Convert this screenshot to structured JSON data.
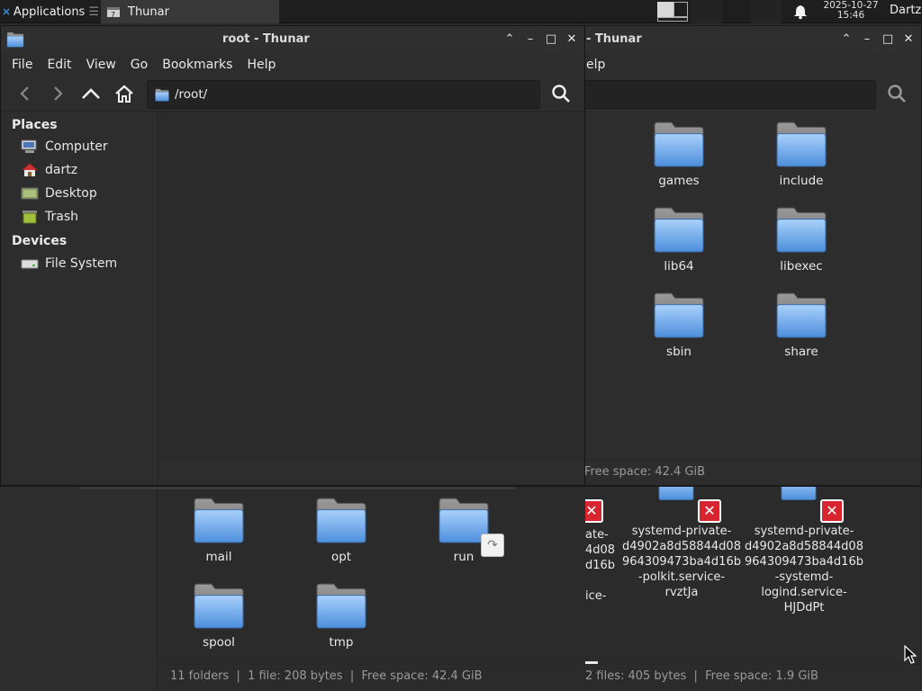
{
  "text": {
    "panel": {
      "apps_label": "Applications",
      "task_label": "Thunar",
      "clock_date": "2025-10-27",
      "clock_time": "15:46",
      "user": "Dartz"
    },
    "back_window": {
      "title": "- Thunar",
      "menu_help_partial": "elp",
      "middle_status": "Free space: 42.4 GiB",
      "bottom_status_left": "11 folders  |  1 file: 208 bytes  |  Free space: 42.4 GiB",
      "bottom_status_right": "2 files: 405 bytes  |  Free space: 1.9 GiB",
      "right_folders": [
        {
          "label": "games"
        },
        {
          "label": "include"
        },
        {
          "label": "lib64"
        },
        {
          "label": "libexec"
        },
        {
          "label": "sbin"
        },
        {
          "label": "share"
        }
      ],
      "bottom_folders": [
        {
          "label": "mail"
        },
        {
          "label": "opt"
        },
        {
          "label": "run"
        },
        {
          "label": "spool"
        },
        {
          "label": "tmp"
        }
      ],
      "private_items": [
        {
          "lines": [
            "ate-",
            "4d08",
            "d16b",
            "",
            "ice-"
          ]
        },
        {
          "lines": [
            "systemd-private-",
            "d4902a8d58844d08",
            "964309473ba4d16b",
            "-polkit.service-",
            "rvztJa"
          ]
        },
        {
          "lines": [
            "systemd-private-",
            "d4902a8d58844d08",
            "964309473ba4d16b",
            "-systemd-",
            "logind.service-",
            "HJDdPt"
          ]
        }
      ]
    },
    "front_window": {
      "title": "root - Thunar",
      "menu": [
        "File",
        "Edit",
        "View",
        "Go",
        "Bookmarks",
        "Help"
      ],
      "path": "/root/",
      "sidebar": {
        "places_header": "Places",
        "places": [
          "Computer",
          "dartz",
          "Desktop",
          "Trash"
        ],
        "devices_header": "Devices",
        "devices": [
          "File System"
        ]
      }
    }
  },
  "meta": {
    "panel": {
      "apps_icon": "xfce-logo-icon",
      "task_icon": "thunar-icon",
      "bell_icon": "notification-bell-icon"
    },
    "front_window": {
      "sidebar": {
        "places_icons": [
          "computer-icon",
          "home-icon",
          "desktop-icon",
          "trash-icon"
        ],
        "devices_icons": [
          "drive-icon"
        ]
      }
    },
    "colors": {
      "panel_bg": "#1e1e1e",
      "window_bg": "#2d2d2d",
      "folder_blue": "#5d9ee6",
      "error_red": "#d6252f"
    }
  }
}
